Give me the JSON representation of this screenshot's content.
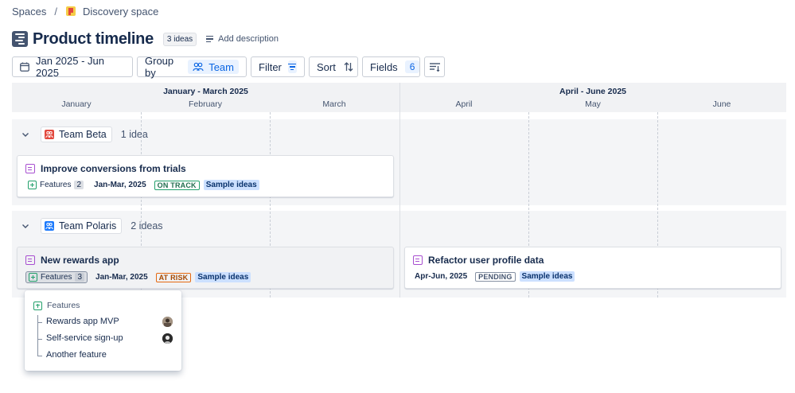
{
  "breadcrumb": {
    "root": "Spaces",
    "separator": "/",
    "space": "Discovery space"
  },
  "page": {
    "title": "Product timeline",
    "idea_count": "3 ideas",
    "add_description": "Add description"
  },
  "toolbar": {
    "date_range": "Jan 2025 - Jun 2025",
    "group_by_label": "Group by",
    "group_by_value": "Team",
    "filter_label": "Filter",
    "sort_label": "Sort",
    "fields_label": "Fields",
    "fields_count": "6"
  },
  "timeline": {
    "quarters": [
      "January - March 2025",
      "April - June 2025"
    ],
    "months": [
      "January",
      "February",
      "March",
      "April",
      "May",
      "June"
    ]
  },
  "groups": [
    {
      "team": "Team Beta",
      "count": "1 idea",
      "icon_color": "#e2483d",
      "cards": [
        {
          "title": "Improve conversions from trials",
          "features_label": "Features",
          "features_count": "2",
          "dates": "Jan-Mar, 2025",
          "status": "ON TRACK",
          "status_color": "#216e4e",
          "tag": "Sample ideas"
        }
      ]
    },
    {
      "team": "Team Polaris",
      "count": "2 ideas",
      "icon_color": "#1d7afc",
      "cards": [
        {
          "title": "New rewards app",
          "features_label": "Features",
          "features_count": "3",
          "dates": "Jan-Mar, 2025",
          "status": "AT RISK",
          "status_color": "#a54800",
          "tag": "Sample ideas"
        },
        {
          "title": "Refactor user profile data",
          "dates": "Apr-Jun, 2025",
          "status": "PENDING",
          "status_color": "#44546f",
          "tag": "Sample ideas"
        }
      ]
    }
  ],
  "features_popup": {
    "header": "Features",
    "items": [
      "Rewards app MVP",
      "Self-service sign-up",
      "Another feature"
    ]
  },
  "colors": {
    "accent": "#0c66e4",
    "accent_bg": "#e9f2ff",
    "idea_icon": "#a84fd0",
    "feature_icon": "#22a06b"
  }
}
